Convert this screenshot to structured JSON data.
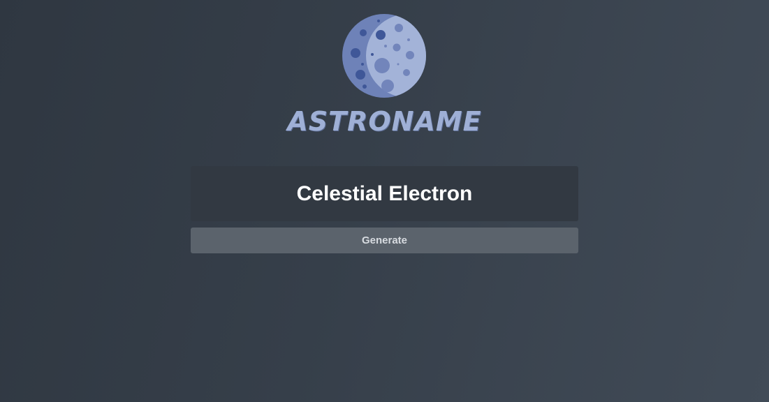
{
  "app": {
    "title": "ASTRONAME",
    "logo_icon": "moon-icon"
  },
  "result": {
    "name": "Celestial Electron"
  },
  "actions": {
    "generate_label": "Generate"
  },
  "colors": {
    "background_start": "#2f3741",
    "background_end": "#414b57",
    "brand": "#9fb0d6",
    "name_box": "#323942",
    "button": "#5b636c",
    "button_text": "#d7dbe0"
  }
}
